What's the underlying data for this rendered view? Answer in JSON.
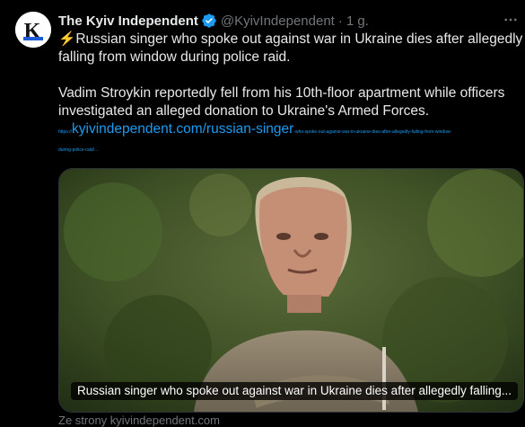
{
  "tweet": {
    "author_name": "The Kyiv Independent",
    "handle": "@KyivIndependent",
    "separator": "·",
    "time": "1 g.",
    "more_icon": "more-dots-icon",
    "avatar_letter": "K",
    "text_p1_emoji": "⚡",
    "text_p1": "Russian singer who spoke out against war in Ukraine dies after allegedly falling from window during police raid.",
    "text_p2": "Vadim Stroykin reportedly fell from his 10th-floor apartment while officers investigated an alleged donation to Ukraine's Armed Forces.",
    "link_prefix": "https://",
    "link_main": "kyivindependent.com/russian-singer",
    "link_suffix": "-who-spoke-out-against-war-in-ukraine-dies-after-allegedly-falling-from-window-",
    "link_suffix2": "during-police-raid/…"
  },
  "card": {
    "caption": "Russian singer who spoke out against war in Ukraine dies after allegedly falling...",
    "source": "Ze strony kyivindependent.com"
  },
  "colors": {
    "background": "#000000",
    "link": "#1d9bf0",
    "verified": "#1d9bf0",
    "muted": "#71767b"
  }
}
